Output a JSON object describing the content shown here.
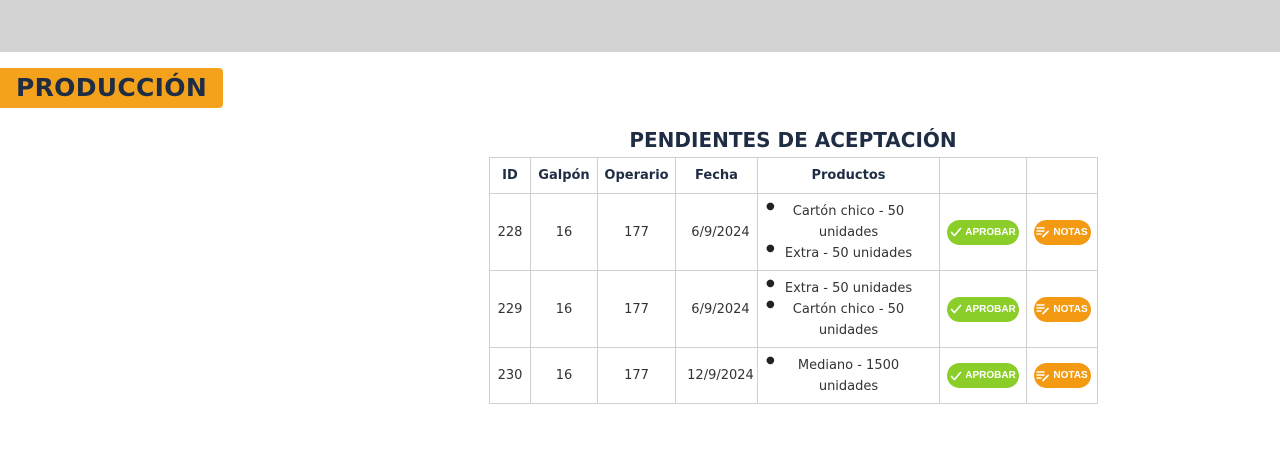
{
  "page": {
    "title": "PRODUCCIÓN"
  },
  "table": {
    "title": "PENDIENTES DE ACEPTACIÓN",
    "headers": {
      "id": "ID",
      "galpon": "Galpón",
      "operario": "Operario",
      "fecha": "Fecha",
      "productos": "Productos"
    },
    "rows": [
      {
        "id": "228",
        "galpon": "16",
        "operario": "177",
        "fecha": "6/9/2024",
        "productos": [
          "Cartón chico - 50 unidades",
          "Extra - 50 unidades"
        ]
      },
      {
        "id": "229",
        "galpon": "16",
        "operario": "177",
        "fecha": "6/9/2024",
        "productos": [
          "Extra - 50 unidades",
          "Cartón chico - 50 unidades"
        ]
      },
      {
        "id": "230",
        "galpon": "16",
        "operario": "177",
        "fecha": "12/9/2024",
        "productos": [
          "Mediano - 1500 unidades"
        ]
      }
    ]
  },
  "actions": {
    "approve_label": "APROBAR",
    "notes_label": "NOTAS",
    "approve_icon": "check-icon",
    "notes_icon": "notes-edit-icon"
  },
  "colors": {
    "topbar": "#d3d3d3",
    "brand_orange": "#f4a21b",
    "approve_green": "#8bce2a",
    "notes_orange": "#f39a12",
    "heading_navy": "#1f2d44"
  }
}
